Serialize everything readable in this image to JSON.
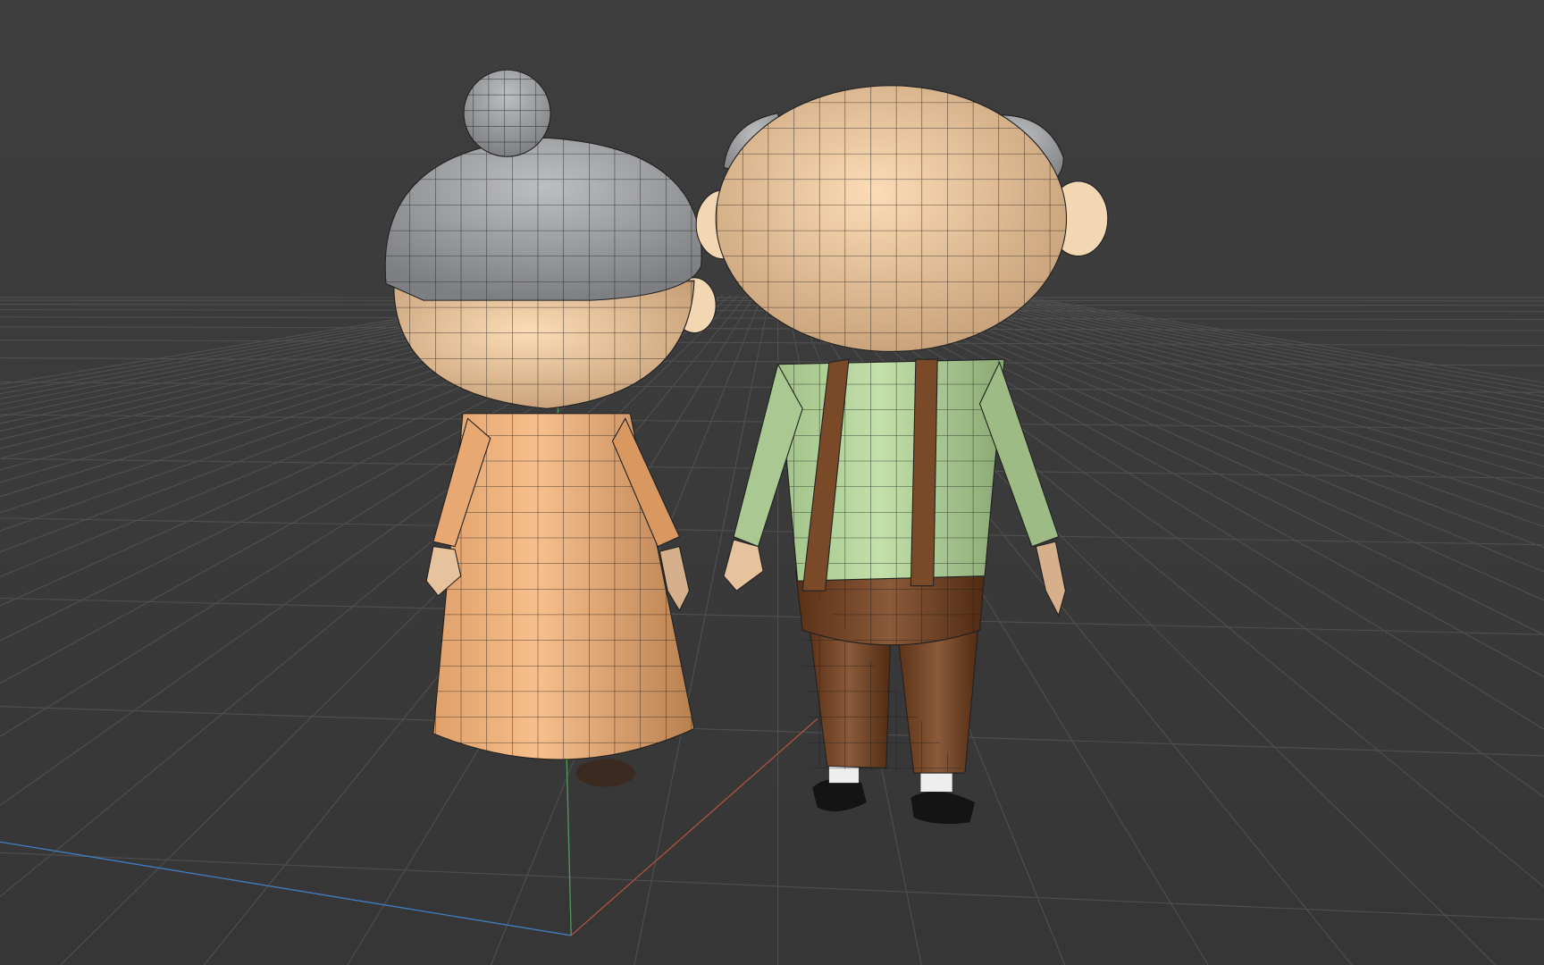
{
  "viewport": {
    "background_color": "#3b3b3b",
    "grid_color": "#555555",
    "axis_colors": {
      "x": "#b2503c",
      "y": "#4f9a5a",
      "z": "#3f7fc0"
    }
  },
  "models": [
    {
      "name": "old-woman",
      "colors": {
        "hair": "#a5a7a9",
        "skin": "#e8c49b",
        "dress": "#eda974"
      }
    },
    {
      "name": "old-man",
      "colors": {
        "hair": "#9a9c9e",
        "skin": "#e9c8a0",
        "shirt": "#b7d59e",
        "pants": "#6e3f20",
        "suspenders": "#7a4a28",
        "shoes": "#151515"
      }
    }
  ]
}
